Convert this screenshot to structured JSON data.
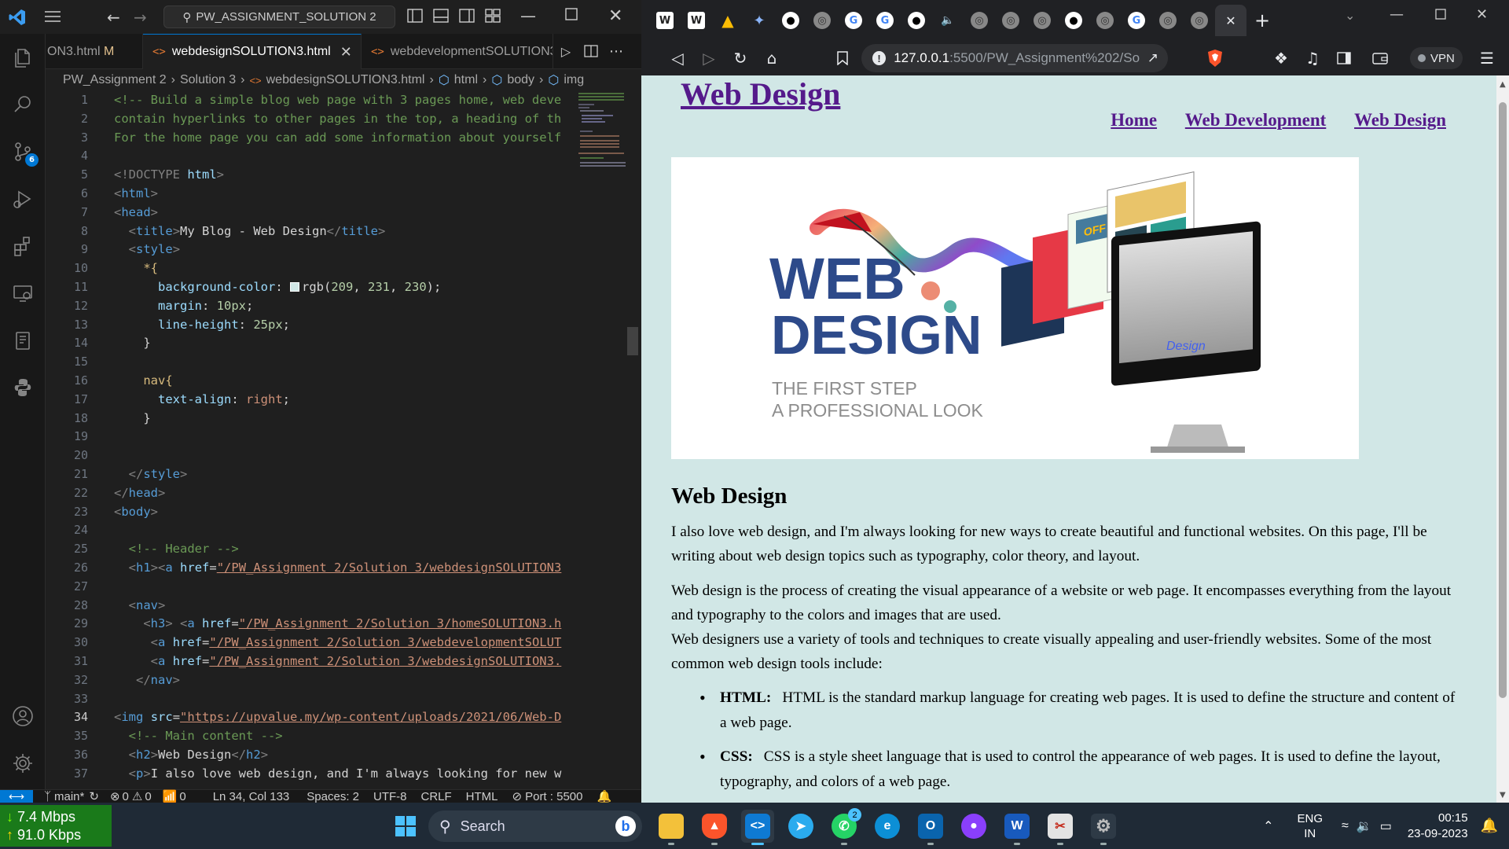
{
  "vscode": {
    "command_center": "PW_ASSIGNMENT_SOLUTION 2",
    "tabs": [
      {
        "label": "ON3.html",
        "suffix": "M"
      },
      {
        "label": "webdesignSOLUTION3.html",
        "active": true
      },
      {
        "label": "webdevelopmentSOLUTION3"
      }
    ],
    "breadcrumb": [
      "PW_Assignment 2",
      "Solution 3",
      "webdesignSOLUTION3.html",
      "html",
      "body",
      "img"
    ],
    "scm_badge": "6",
    "line_numbers": [
      "1",
      "2",
      "3",
      "4",
      "5",
      "6",
      "7",
      "8",
      "9",
      "10",
      "11",
      "12",
      "13",
      "14",
      "15",
      "16",
      "17",
      "18",
      "19",
      "20",
      "21",
      "22",
      "23",
      "24",
      "25",
      "26",
      "27",
      "28",
      "29",
      "30",
      "31",
      "32",
      "33",
      "34",
      "35",
      "36",
      "37"
    ],
    "current_line": "34",
    "code": {
      "l1": "<!-- Build a simple blog web page with 3 pages home, web deve",
      "l2": "contain hyperlinks to other pages in the top, a heading of th",
      "l3": "For the home page you can add some information about yourself",
      "l5a": "<!DOCTYPE ",
      "l5b": "html",
      "l5c": ">",
      "l6": "html",
      "l7": "head",
      "l8a": "title",
      "l8b": "My Blog - Web Design",
      "l8c": "title",
      "l9": "style",
      "l10": "*{",
      "l11a": "background-color",
      "l11b": "rgb(",
      "l11c": "209",
      "l11d": "231",
      "l11e": "230",
      "l12a": "margin",
      "l12b": "10px",
      "l13a": "line-height",
      "l13b": "25px",
      "l14": "}",
      "l16": "nav{",
      "l17a": "text-align",
      "l17b": "right",
      "l18": "}",
      "l21": "style",
      "l22": "head",
      "l23": "body",
      "l25": "<!-- Header -->",
      "l26a": "h1",
      "l26b": "a",
      "l26c": "href",
      "l26d": "\"/PW_Assignment 2/Solution 3/webdesignSOLUTION3",
      "l28": "nav",
      "l29a": "h3",
      "l29b": "a",
      "l29c": "href",
      "l29d": "\"/PW_Assignment 2/Solution 3/homeSOLUTION3.h",
      "l30a": "a",
      "l30b": "href",
      "l30c": "\"/PW_Assignment 2/Solution 3/webdevelopmentSOLUT",
      "l31a": "a",
      "l31b": "href",
      "l31c": "\"/PW_Assignment 2/Solution 3/webdesignSOLUTION3.",
      "l32": "nav",
      "l34a": "img",
      "l34b": "src",
      "l34c": "\"https://upvalue.my/wp-content/uploads/2021/06/Web-D",
      "l35": "<!-- Main content -->",
      "l36a": "h2",
      "l36b": "Web Design",
      "l36c": "h2",
      "l37a": "p",
      "l37b": "I also love web design, and I'm always looking for new w"
    },
    "status": {
      "branch": "main*",
      "errors": "0",
      "warnings": "0",
      "ports": "0",
      "position": "Ln 34, Col 133",
      "spaces": "Spaces: 2",
      "encoding": "UTF-8",
      "eol": "CRLF",
      "language": "HTML",
      "port": "Port : 5500"
    }
  },
  "browser": {
    "url_host": "127.0.0.1",
    "url_path": ":5500/PW_Assignment%202/So...",
    "vpn_label": "VPN",
    "site": {
      "h1": "Web Design",
      "nav": [
        "Home",
        "Web Development",
        "Web Design"
      ],
      "hero": {
        "line1": "WEB",
        "line2": "DESIGN",
        "tag1": "THE FIRST STEP",
        "tag2": "A PROFESSIONAL LOOK",
        "sale": "OFF",
        "screen": "Design"
      },
      "h2": "Web Design",
      "p1": "I also love web design, and I'm always looking for new ways to create beautiful and functional websites. On this page, I'll be writing about web design topics such as typography, color theory, and layout.",
      "p2": "Web design is the process of creating the visual appearance of a website or web page. It encompasses everything from the layout and typography to the colors and images that are used.",
      "p3": "Web designers use a variety of tools and techniques to create visually appealing and user-friendly websites. Some of the most common web design tools include:",
      "list": [
        {
          "term": "HTML:",
          "desc": "HTML is the standard markup language for creating web pages. It is used to define the structure and content of a web page."
        },
        {
          "term": "CSS:",
          "desc": "CSS is a style sheet language that is used to control the appearance of web pages. It is used to define the layout, typography, and colors of a web page."
        }
      ]
    }
  },
  "taskbar": {
    "down_speed": "7.4 Mbps",
    "up_speed": "91.0 Kbps",
    "search_placeholder": "Search",
    "whatsapp_badge": "2",
    "lang1": "ENG",
    "lang2": "IN",
    "time": "00:15",
    "date": "23-09-2023"
  },
  "colors": {
    "page_bg": "#d1e7e6",
    "link": "#551a8b",
    "vscode_accent": "#0078d4"
  }
}
